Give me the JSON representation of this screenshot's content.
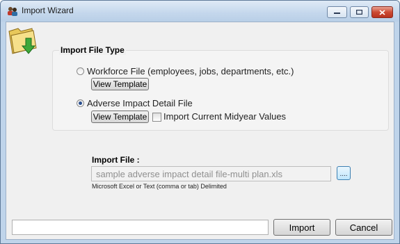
{
  "window": {
    "title": "Import Wizard",
    "controls": [
      "minimize",
      "maximize",
      "close"
    ]
  },
  "icons": {
    "app": "people-icon",
    "header": "folder-import-icon"
  },
  "file_type_group": {
    "title": "Import File Type",
    "options": [
      {
        "label": "Workforce File (employees, jobs, departments, etc.)",
        "selected": false,
        "view_template_label": "View Template"
      },
      {
        "label": "Adverse Impact Detail File",
        "selected": true,
        "view_template_label": "View Template"
      }
    ],
    "midyear_checkbox": {
      "label": "Import Current Midyear Values",
      "checked": false
    }
  },
  "import_file": {
    "label": "Import File :",
    "value": "sample adverse impact detail file-multi plan.xls",
    "hint": "Microsoft Excel or Text (comma or tab) Delimited",
    "browse_label": "...."
  },
  "footer": {
    "status_text": "",
    "import_label": "Import",
    "cancel_label": "Cancel"
  }
}
